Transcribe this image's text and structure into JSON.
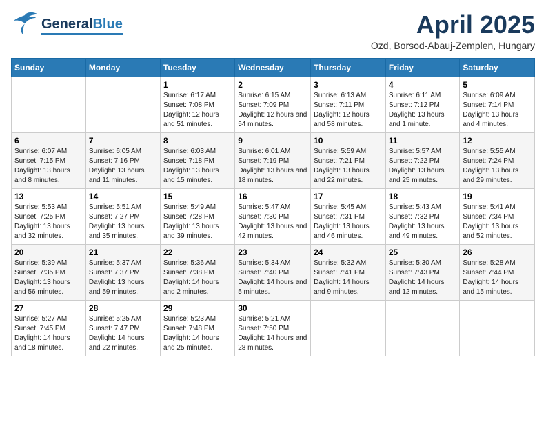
{
  "header": {
    "logo_general": "General",
    "logo_blue": "Blue",
    "month": "April 2025",
    "location": "Ozd, Borsod-Abauj-Zemplen, Hungary"
  },
  "weekdays": [
    "Sunday",
    "Monday",
    "Tuesday",
    "Wednesday",
    "Thursday",
    "Friday",
    "Saturday"
  ],
  "weeks": [
    [
      {
        "day": "",
        "info": ""
      },
      {
        "day": "",
        "info": ""
      },
      {
        "day": "1",
        "info": "Sunrise: 6:17 AM\nSunset: 7:08 PM\nDaylight: 12 hours and 51 minutes."
      },
      {
        "day": "2",
        "info": "Sunrise: 6:15 AM\nSunset: 7:09 PM\nDaylight: 12 hours and 54 minutes."
      },
      {
        "day": "3",
        "info": "Sunrise: 6:13 AM\nSunset: 7:11 PM\nDaylight: 12 hours and 58 minutes."
      },
      {
        "day": "4",
        "info": "Sunrise: 6:11 AM\nSunset: 7:12 PM\nDaylight: 13 hours and 1 minute."
      },
      {
        "day": "5",
        "info": "Sunrise: 6:09 AM\nSunset: 7:14 PM\nDaylight: 13 hours and 4 minutes."
      }
    ],
    [
      {
        "day": "6",
        "info": "Sunrise: 6:07 AM\nSunset: 7:15 PM\nDaylight: 13 hours and 8 minutes."
      },
      {
        "day": "7",
        "info": "Sunrise: 6:05 AM\nSunset: 7:16 PM\nDaylight: 13 hours and 11 minutes."
      },
      {
        "day": "8",
        "info": "Sunrise: 6:03 AM\nSunset: 7:18 PM\nDaylight: 13 hours and 15 minutes."
      },
      {
        "day": "9",
        "info": "Sunrise: 6:01 AM\nSunset: 7:19 PM\nDaylight: 13 hours and 18 minutes."
      },
      {
        "day": "10",
        "info": "Sunrise: 5:59 AM\nSunset: 7:21 PM\nDaylight: 13 hours and 22 minutes."
      },
      {
        "day": "11",
        "info": "Sunrise: 5:57 AM\nSunset: 7:22 PM\nDaylight: 13 hours and 25 minutes."
      },
      {
        "day": "12",
        "info": "Sunrise: 5:55 AM\nSunset: 7:24 PM\nDaylight: 13 hours and 29 minutes."
      }
    ],
    [
      {
        "day": "13",
        "info": "Sunrise: 5:53 AM\nSunset: 7:25 PM\nDaylight: 13 hours and 32 minutes."
      },
      {
        "day": "14",
        "info": "Sunrise: 5:51 AM\nSunset: 7:27 PM\nDaylight: 13 hours and 35 minutes."
      },
      {
        "day": "15",
        "info": "Sunrise: 5:49 AM\nSunset: 7:28 PM\nDaylight: 13 hours and 39 minutes."
      },
      {
        "day": "16",
        "info": "Sunrise: 5:47 AM\nSunset: 7:30 PM\nDaylight: 13 hours and 42 minutes."
      },
      {
        "day": "17",
        "info": "Sunrise: 5:45 AM\nSunset: 7:31 PM\nDaylight: 13 hours and 46 minutes."
      },
      {
        "day": "18",
        "info": "Sunrise: 5:43 AM\nSunset: 7:32 PM\nDaylight: 13 hours and 49 minutes."
      },
      {
        "day": "19",
        "info": "Sunrise: 5:41 AM\nSunset: 7:34 PM\nDaylight: 13 hours and 52 minutes."
      }
    ],
    [
      {
        "day": "20",
        "info": "Sunrise: 5:39 AM\nSunset: 7:35 PM\nDaylight: 13 hours and 56 minutes."
      },
      {
        "day": "21",
        "info": "Sunrise: 5:37 AM\nSunset: 7:37 PM\nDaylight: 13 hours and 59 minutes."
      },
      {
        "day": "22",
        "info": "Sunrise: 5:36 AM\nSunset: 7:38 PM\nDaylight: 14 hours and 2 minutes."
      },
      {
        "day": "23",
        "info": "Sunrise: 5:34 AM\nSunset: 7:40 PM\nDaylight: 14 hours and 5 minutes."
      },
      {
        "day": "24",
        "info": "Sunrise: 5:32 AM\nSunset: 7:41 PM\nDaylight: 14 hours and 9 minutes."
      },
      {
        "day": "25",
        "info": "Sunrise: 5:30 AM\nSunset: 7:43 PM\nDaylight: 14 hours and 12 minutes."
      },
      {
        "day": "26",
        "info": "Sunrise: 5:28 AM\nSunset: 7:44 PM\nDaylight: 14 hours and 15 minutes."
      }
    ],
    [
      {
        "day": "27",
        "info": "Sunrise: 5:27 AM\nSunset: 7:45 PM\nDaylight: 14 hours and 18 minutes."
      },
      {
        "day": "28",
        "info": "Sunrise: 5:25 AM\nSunset: 7:47 PM\nDaylight: 14 hours and 22 minutes."
      },
      {
        "day": "29",
        "info": "Sunrise: 5:23 AM\nSunset: 7:48 PM\nDaylight: 14 hours and 25 minutes."
      },
      {
        "day": "30",
        "info": "Sunrise: 5:21 AM\nSunset: 7:50 PM\nDaylight: 14 hours and 28 minutes."
      },
      {
        "day": "",
        "info": ""
      },
      {
        "day": "",
        "info": ""
      },
      {
        "day": "",
        "info": ""
      }
    ]
  ]
}
